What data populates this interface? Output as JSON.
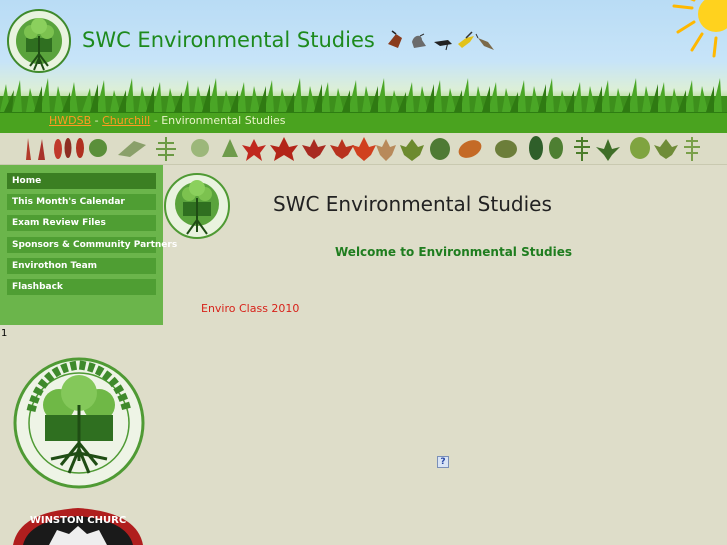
{
  "header": {
    "site_title": "SWC Environmental Studies",
    "logo_text": "SWC ENVIRONMENTAL STUDIES"
  },
  "breadcrumb": {
    "items": [
      "HWDSB",
      "Churchill",
      "Environmental Studies"
    ],
    "separator": " - "
  },
  "sidebar": {
    "items": [
      {
        "label": "Home"
      },
      {
        "label": "This Month's Calendar"
      },
      {
        "label": "Exam Review Files"
      },
      {
        "label": "Sponsors & Community Partners"
      },
      {
        "label": "Envirothon Team"
      },
      {
        "label": "Flashback"
      }
    ],
    "stray_text": "1"
  },
  "main": {
    "title": "SWC Environmental Studies",
    "welcome": "Welcome to Environmental Studies",
    "enviro_link": "Enviro Class 2010",
    "broken_image_glyph": "?"
  },
  "crest": {
    "text": "WINSTON CHURC"
  },
  "colors": {
    "title_green": "#1d8a1d",
    "nav_bg": "#4f9e33",
    "sidebar_bg": "#6bb54b",
    "link_orange": "#ff9a22",
    "enviro_red": "#d7221a"
  }
}
